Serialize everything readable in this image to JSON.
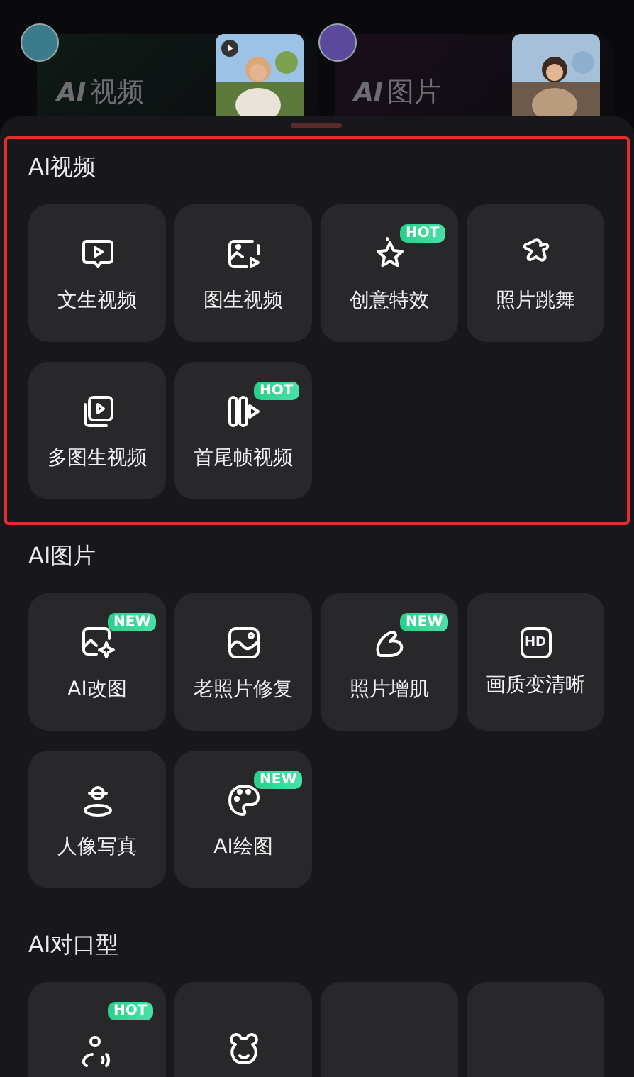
{
  "header_cards": [
    {
      "logo": "AI",
      "title": "视频",
      "has_play": true
    },
    {
      "logo": "AI",
      "title": "图片",
      "has_play": false
    }
  ],
  "sections": [
    {
      "title": "AI视频",
      "highlighted": true,
      "items": [
        {
          "kind": "tool",
          "label": "文生视频"
        },
        {
          "kind": "tool",
          "label": "图生视频"
        },
        {
          "kind": "tool",
          "label": "创意特效",
          "badge": "HOT"
        },
        {
          "kind": "tool",
          "label": "照片跳舞"
        },
        {
          "kind": "tool",
          "label": "多图生视频"
        },
        {
          "kind": "tool",
          "label": "首尾帧视频",
          "badge": "HOT"
        }
      ]
    },
    {
      "title": "AI图片",
      "highlighted": false,
      "items": [
        {
          "kind": "tool",
          "label": "AI改图",
          "badge": "NEW"
        },
        {
          "kind": "tool",
          "label": "老照片修复"
        },
        {
          "kind": "tool",
          "label": "照片增肌",
          "badge": "NEW"
        },
        {
          "kind": "tool",
          "label": "画质变清晰",
          "icon_text": "HD"
        },
        {
          "kind": "tool",
          "label": "人像写真"
        },
        {
          "kind": "tool",
          "label": "AI绘图",
          "badge": "NEW"
        }
      ]
    },
    {
      "title": "AI对口型",
      "highlighted": false,
      "items": [
        {
          "kind": "tool",
          "badge": "HOT"
        },
        {
          "kind": "tool"
        },
        {
          "kind": "empty"
        },
        {
          "kind": "empty"
        }
      ]
    }
  ]
}
